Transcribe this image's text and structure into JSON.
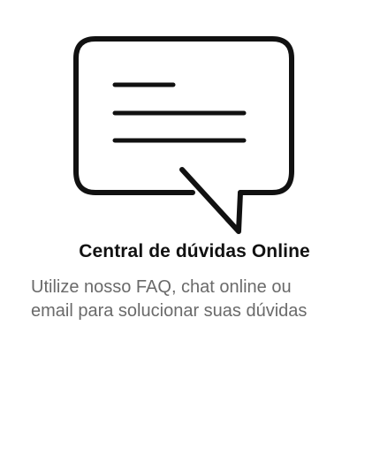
{
  "feature": {
    "icon": "chat-bubble-icon",
    "title": "Central de dúvidas Online",
    "description_line1": "Utilize  nosso FAQ, chat online ou",
    "description_line2": "email para solucionar suas dúvidas"
  },
  "colors": {
    "icon_stroke": "#111111",
    "title": "#111111",
    "description": "#6a6a6a",
    "background": "#ffffff"
  }
}
